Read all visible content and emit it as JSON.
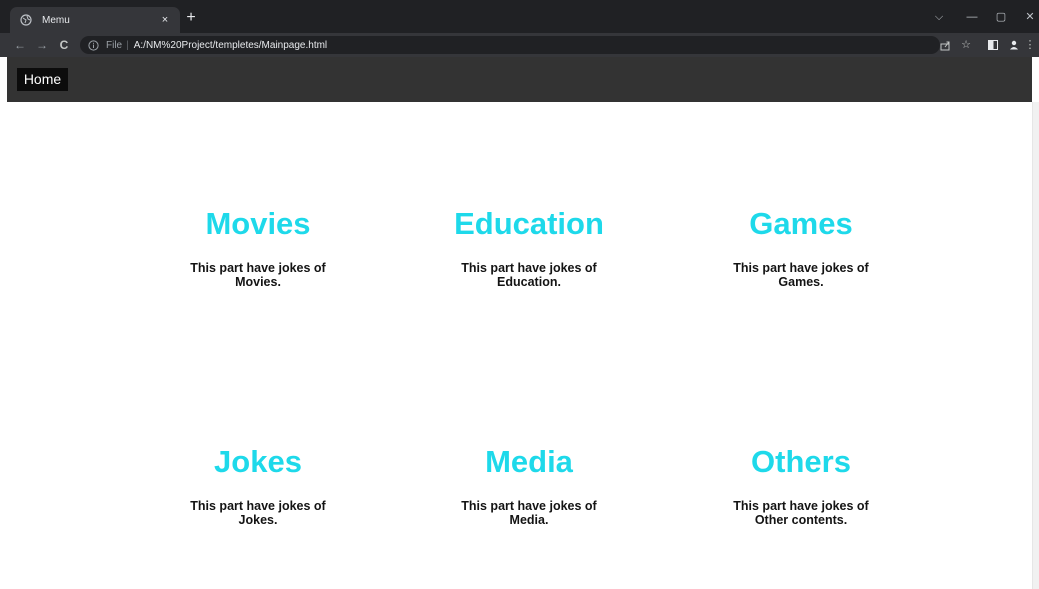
{
  "browser": {
    "tab_title": "Memu",
    "tab_close": "×",
    "new_tab": "+",
    "window_controls": {
      "dropdown": "⌵",
      "minimize": "—",
      "restore": "▢",
      "close": "✕"
    },
    "nav": {
      "back": "←",
      "forward": "→",
      "reload": "C"
    },
    "omnibox": {
      "scheme_label": "File",
      "separator": "|",
      "url": "A:/NM%20Project/templetes/Mainpage.html"
    },
    "toolbar_icons": [
      "share-icon",
      "star-icon",
      "sidepanel-icon",
      "profile-icon",
      "menu-icon"
    ]
  },
  "nav": {
    "home_label": "Home"
  },
  "cards": [
    {
      "title": "Movies",
      "desc": "This part have jokes of Movies."
    },
    {
      "title": "Education",
      "desc": "This part have jokes of Education."
    },
    {
      "title": "Games",
      "desc": "This part have jokes of Games."
    },
    {
      "title": "Jokes",
      "desc": "This part have jokes of Jokes."
    },
    {
      "title": "Media",
      "desc": "This part have jokes of Media."
    },
    {
      "title": "Others",
      "desc": "This part have jokes of Other contents."
    }
  ],
  "colors": {
    "heading": "#1ed9ea",
    "navbar": "#333333",
    "home_button": "#0c0c0c"
  }
}
